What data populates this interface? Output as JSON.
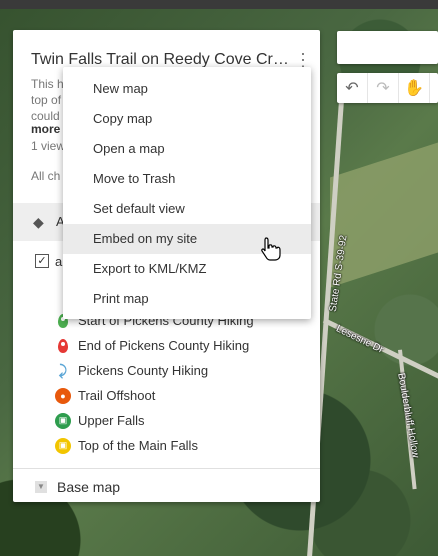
{
  "panel": {
    "title": "Twin Falls Trail on Reedy Cove Cre...",
    "description_lines": [
      "This h",
      "top of",
      "could"
    ],
    "more": "more",
    "views": "1 view",
    "all_changes": "All ch"
  },
  "layer": {
    "name": "A",
    "all_items": "a"
  },
  "legend": [
    {
      "label": "Start of Pickens County Hiking",
      "icon": "green-pin-icon",
      "color": "#4caf50"
    },
    {
      "label": "End of Pickens County Hiking",
      "icon": "red-pin-icon",
      "color": "#e53935"
    },
    {
      "label": "Pickens County Hiking",
      "icon": "hiking-path-icon",
      "color": "#5ba6d6"
    },
    {
      "label": "Trail Offshoot",
      "icon": "orange-circle-icon",
      "color": "#e8590c"
    },
    {
      "label": "Upper Falls",
      "icon": "green-circle-icon",
      "color": "#2e9d4e"
    },
    {
      "label": "Top of the Main Falls",
      "icon": "yellow-circle-icon",
      "color": "#f2c500"
    }
  ],
  "basemap": {
    "label": "Base map"
  },
  "menu": {
    "items": [
      {
        "label": "New map"
      },
      {
        "label": "Copy map"
      },
      {
        "label": "Open a map"
      },
      {
        "label": "Move to Trash"
      },
      {
        "label": "Set default view"
      },
      {
        "label": "Embed on my site"
      },
      {
        "label": "Export to KML/KMZ"
      },
      {
        "label": "Print map"
      }
    ],
    "hovered_index": 5
  },
  "map": {
    "road_labels": [
      "State Rd S-39-92",
      "Lesesne Dr",
      "Boulderbluff Hollow"
    ]
  }
}
